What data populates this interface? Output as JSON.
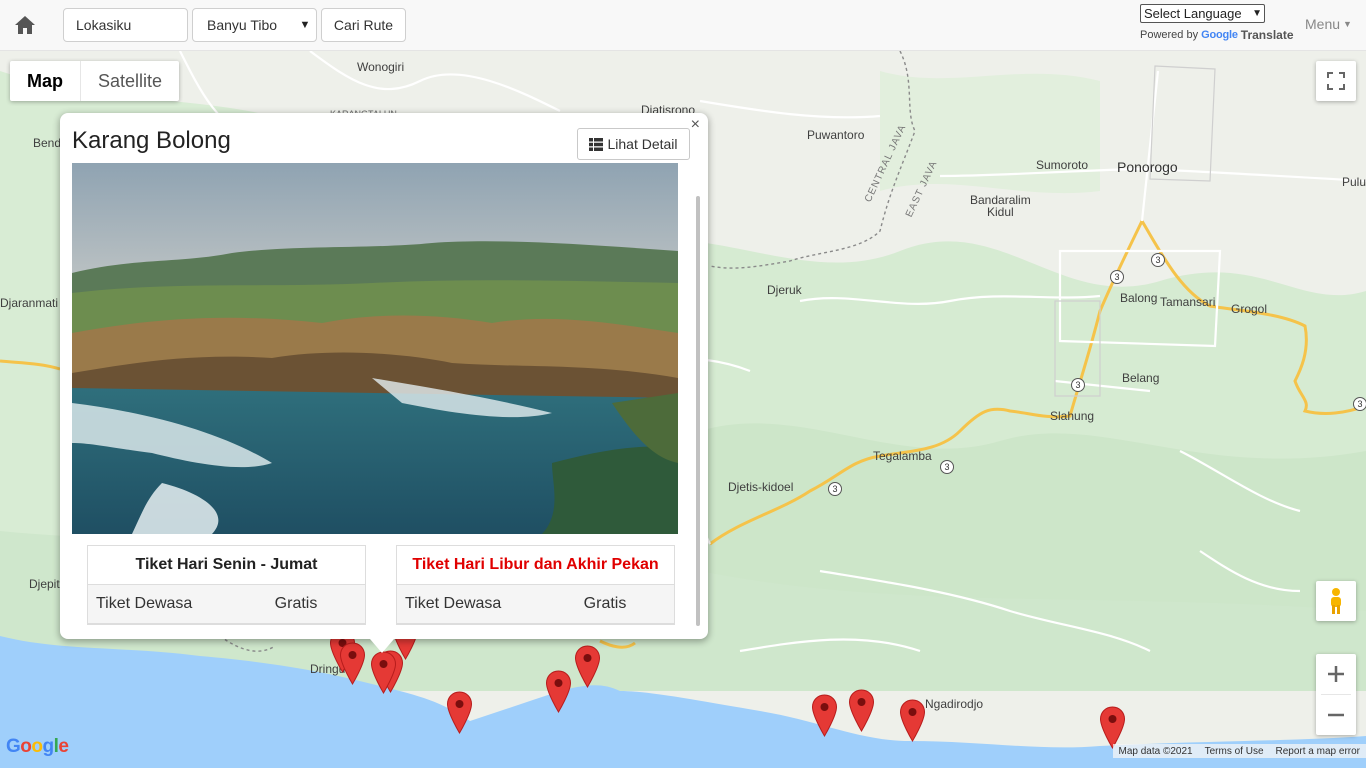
{
  "header": {
    "location_value": "Lokasiku",
    "destination_selected": "Banyu Tibo",
    "route_button": "Cari Rute",
    "language_select": "Select Language",
    "powered_by": "Powered by",
    "google_word": "Google",
    "translate_word": "Translate",
    "menu_label": "Menu"
  },
  "map": {
    "type_buttons": [
      "Map",
      "Satellite"
    ],
    "active_type": "Map",
    "labels": {
      "wonogiri": "Wonogiri",
      "karangtalun": "KARANGTALUN",
      "bend": "Bend",
      "djatisrono": "Djatisrono",
      "puwantoro": "Puwantoro",
      "sumoroto": "Sumoroto",
      "ponorogo": "Ponorogo",
      "pulu": "Pulu",
      "bandaralim": "Bandaralim",
      "kidul": "Kidul",
      "djeruk": "Djeruk",
      "balong": "Balong",
      "tamansari": "Tamansari",
      "grogol": "Grogol",
      "belang": "Belang",
      "slahung": "Slahung",
      "tegalamba": "Tegalamba",
      "djetis_kidoel": "Djetis-kidoel",
      "djaranmati": "Djaranmati",
      "djepit": "Djepit",
      "dringu": "Dringu",
      "ngadirodjo": "Ngadirodjo",
      "central_java": "CENTRAL JAVA",
      "east_java": "EAST JAVA",
      "route_no": "3"
    },
    "attribution": [
      "Map data ©2021",
      "Terms of Use",
      "Report a map error"
    ],
    "logo": "Google"
  },
  "info_window": {
    "title": "Karang Bolong",
    "detail_button": "Lihat Detail",
    "close_symbol": "×",
    "weekday_table": {
      "heading": "Tiket Hari Senin - Jumat",
      "rows": [
        {
          "label": "Tiket Dewasa",
          "value": "Gratis"
        }
      ]
    },
    "weekend_table": {
      "heading": "Tiket Hari Libur dan Akhir Pekan",
      "rows": [
        {
          "label": "Tiket Dewasa",
          "value": "Gratis"
        }
      ]
    }
  },
  "colors": {
    "map_land": "#eef0ea",
    "forest": "#cfe8cf",
    "sea": "#9fcffb",
    "road": "#f5c34a",
    "pin": "#e53935",
    "weekend_heading": "#e00000"
  }
}
